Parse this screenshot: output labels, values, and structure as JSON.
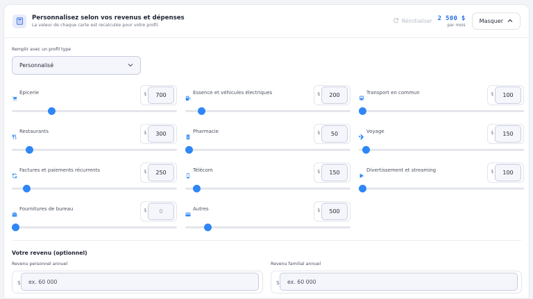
{
  "header": {
    "title": "Personnalisez selon vos revenus et dépenses",
    "subtitle": "La valeur de chaque carte est recalculée pour votre profil.",
    "reset_label": "Réinitialiser",
    "total_value": "2 500 $",
    "total_unit": "par mois",
    "hide_label": "Masquer"
  },
  "profile": {
    "label": "Remplir avec un profil type",
    "selected": "Personnalisé"
  },
  "currency": "$",
  "accent_color": "#2f86f6",
  "categories": [
    {
      "label": "Épicerie",
      "value": "700",
      "icon": "cart-icon",
      "level": 0.23
    },
    {
      "label": "Essence et véhicules électriques",
      "value": "200",
      "icon": "fuel-icon",
      "level": 0.08
    },
    {
      "label": "Transport en commun",
      "value": "100",
      "icon": "bus-icon",
      "level": 0.0
    },
    {
      "label": "Restaurants",
      "value": "300",
      "icon": "utensils-icon",
      "level": 0.09
    },
    {
      "label": "Pharmacie",
      "value": "50",
      "icon": "pharmacy-icon",
      "level": 0.0
    },
    {
      "label": "Voyage",
      "value": "150",
      "icon": "plane-icon",
      "level": 0.02
    },
    {
      "label": "Factures et paiements récurrents",
      "value": "250",
      "icon": "recurring-icon",
      "level": 0.07
    },
    {
      "label": "Télécom",
      "value": "150",
      "icon": "phone-icon",
      "level": 0.05
    },
    {
      "label": "Divertissement et streaming",
      "value": "100",
      "icon": "play-icon",
      "level": 0.0
    },
    {
      "label": "Fournitures de bureau",
      "value": "0",
      "icon": "briefcase-icon",
      "level": 0.0
    },
    {
      "label": "Autres",
      "value": "500",
      "icon": "card-icon",
      "level": 0.12
    }
  ],
  "income": {
    "title": "Votre revenu (optionnel)",
    "personal_label": "Revenu personnel annuel",
    "personal_placeholder": "ex. 60 000",
    "family_label": "Revenu familial annuel",
    "family_placeholder": "ex. 60 000"
  }
}
